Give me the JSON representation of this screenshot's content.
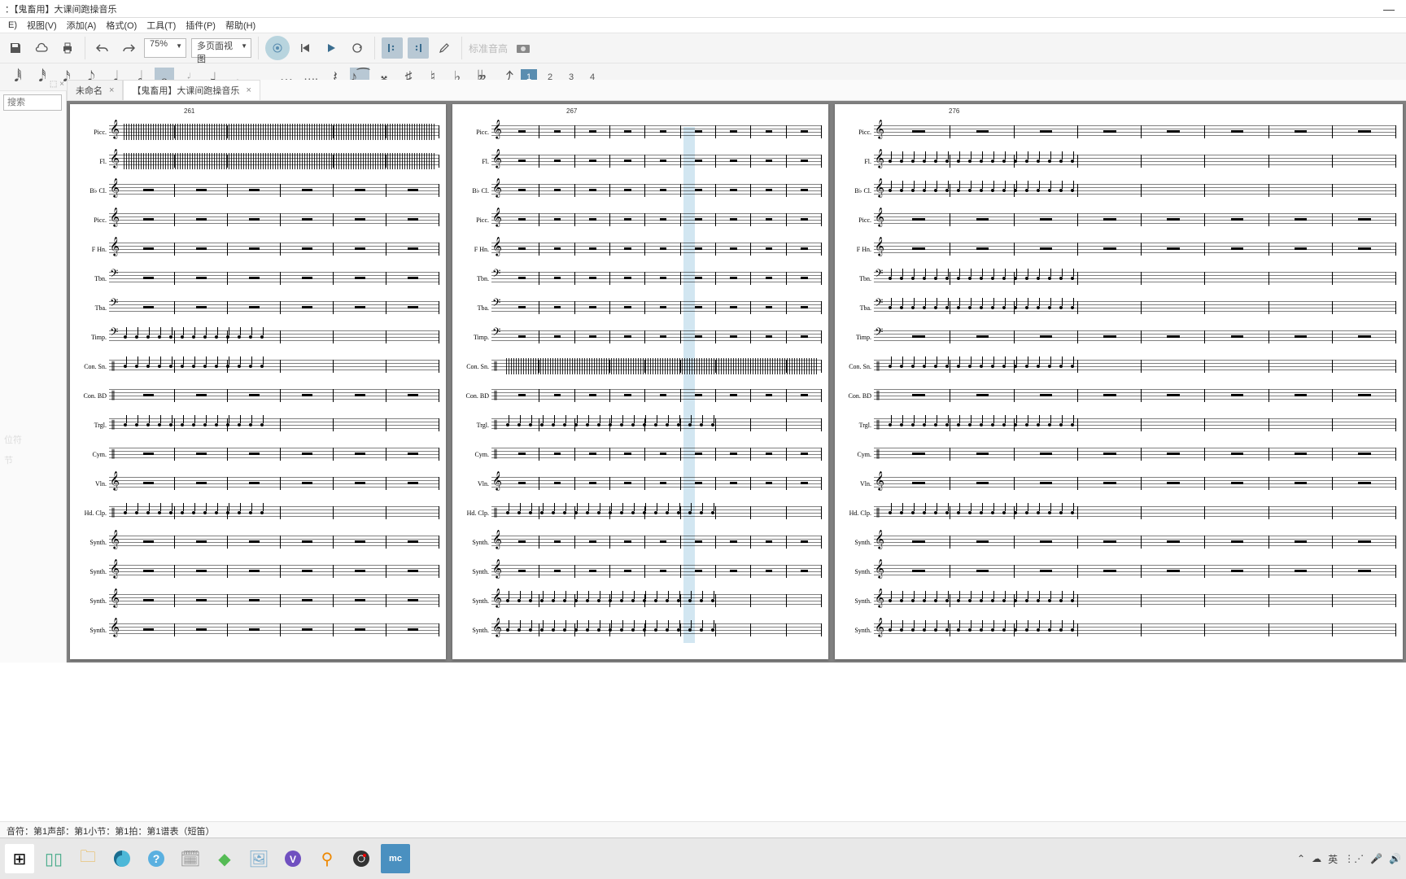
{
  "title": "：【鬼畜用】大课间跑操音乐",
  "menu": {
    "file": "E)",
    "view": "视图(V)",
    "add": "添加(A)",
    "format": "格式(O)",
    "tool": "工具(T)",
    "plugin": "插件(P)",
    "help": "帮助(H)"
  },
  "toolbar": {
    "zoom": "75%",
    "viewmode": "多页面视图",
    "pitch_std": "标准音高"
  },
  "voices": {
    "v1": "1",
    "v2": "2",
    "v3": "3",
    "v4": "4"
  },
  "search_placeholder": "搜索",
  "palette": {
    "p2": "位符",
    "p3": "节"
  },
  "tabs": {
    "t1": "未命名",
    "t2": "【鬼畜用】大课间跑操音乐",
    "x": "×"
  },
  "measure_numbers": {
    "p1": "261",
    "p2": "267",
    "p3": "276"
  },
  "instruments": [
    "Picc.",
    "Fl.",
    "B♭ Cl.",
    "Picc.",
    "F Hn.",
    "Tbn.",
    "Tba.",
    "Timp.",
    "Con. Sn.",
    "Con. BD",
    "Trgl.",
    "Cym.",
    "Vln.",
    "Hd. Clp.",
    "Synth.",
    "Synth.",
    "Synth.",
    "Synth."
  ],
  "clef_map": {
    "treble": "𝄞",
    "bass": "𝄢",
    "perc": "𝄥"
  },
  "staff_types": [
    "treble",
    "treble",
    "treble",
    "treble",
    "treble",
    "bass",
    "bass",
    "bass",
    "perc",
    "perc",
    "perc",
    "perc",
    "treble",
    "perc",
    "treble",
    "treble",
    "treble",
    "treble"
  ],
  "status": "音符：第1声部：第1小节：第1拍：第1谱表（短笛）",
  "tray": {
    "ime": "英"
  }
}
